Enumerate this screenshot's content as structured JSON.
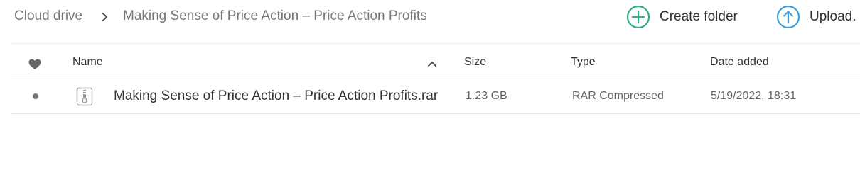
{
  "breadcrumb": {
    "root": "Cloud drive",
    "current": "Making Sense of Price Action – Price Action Profits"
  },
  "actions": {
    "create_folder": "Create folder",
    "upload": "Upload."
  },
  "table": {
    "columns": {
      "name": "Name",
      "size": "Size",
      "type": "Type",
      "date_added": "Date added"
    },
    "rows": [
      {
        "name": "Making Sense of Price Action – Price Action Profits.rar",
        "size": "1.23 GB",
        "type": "RAR Compressed",
        "date_added": "5/19/2022, 18:31"
      }
    ]
  },
  "colors": {
    "create_accent": "#2fae7b",
    "upload_accent": "#3a9fdc",
    "muted_text": "#777777"
  },
  "icons": {
    "breadcrumb_separator": "chevron-right-icon",
    "create_folder": "plus-circle-icon",
    "upload": "arrow-up-circle-icon",
    "favorite_column": "heart-icon",
    "sort": "chevron-up-icon",
    "file_type": "zip-file-icon"
  }
}
